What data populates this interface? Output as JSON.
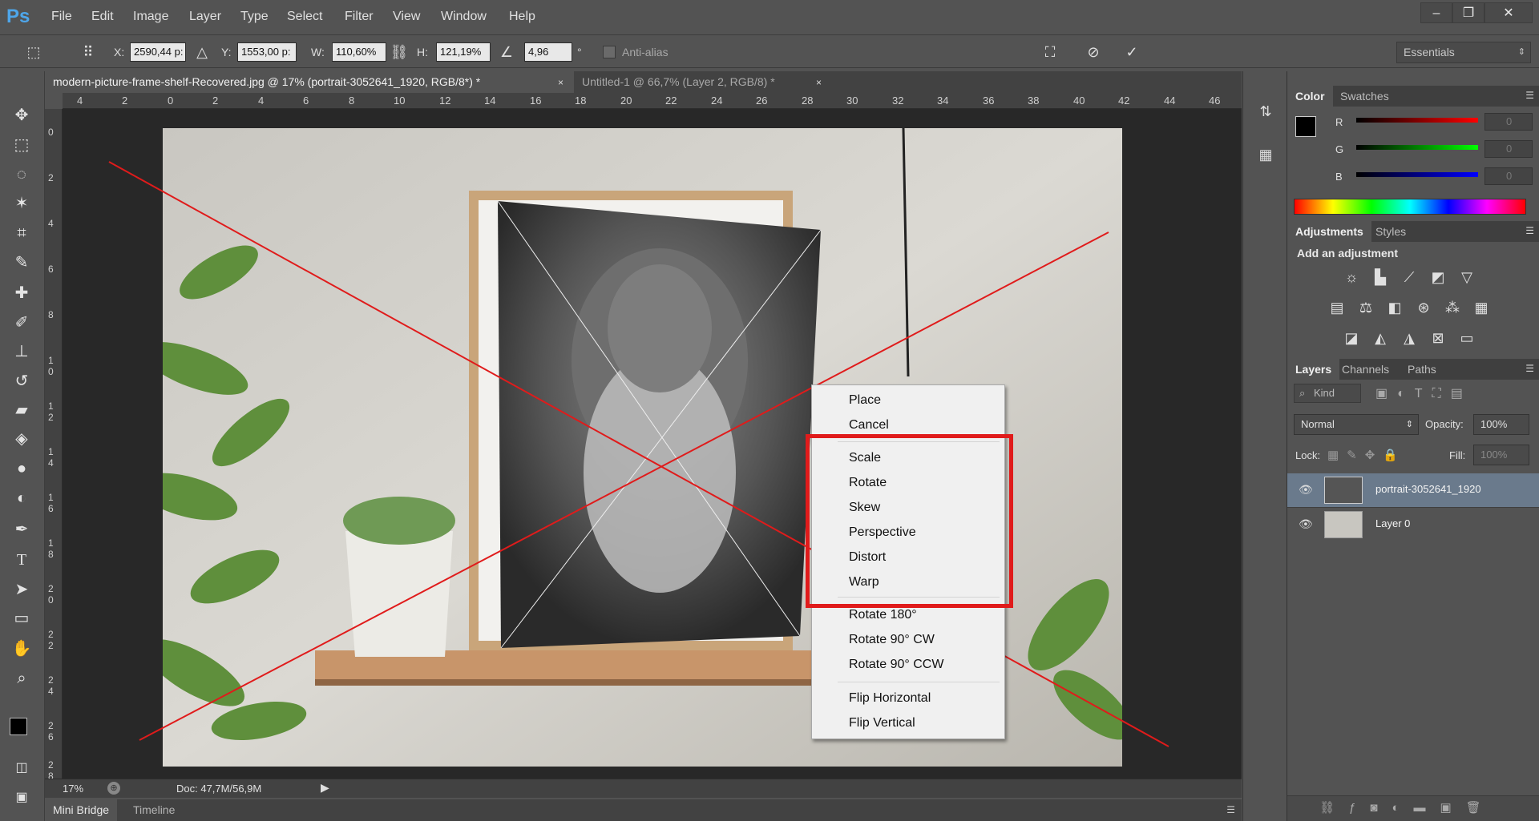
{
  "app": {
    "logo": "Ps"
  },
  "menu": [
    "File",
    "Edit",
    "Image",
    "Layer",
    "Type",
    "Select",
    "Filter",
    "View",
    "Window",
    "Help"
  ],
  "window_controls": {
    "minimize": "–",
    "restore": "❐",
    "close": "✕"
  },
  "options": {
    "x_label": "X:",
    "x_value": "2590,44 p:",
    "y_label": "Y:",
    "y_value": "1553,00 p:",
    "w_label": "W:",
    "w_value": "110,60%",
    "h_label": "H:",
    "h_value": "121,19%",
    "angle_value": "4,96",
    "degree": "°",
    "antialias": "Anti-alias",
    "workspace": "Essentials"
  },
  "tabs": [
    {
      "label": "modern-picture-frame-shelf-Recovered.jpg @ 17% (portrait-3052641_1920, RGB/8*) *",
      "close": "×"
    },
    {
      "label": "Untitled-1 @ 66,7% (Layer 2, RGB/8) *",
      "close": "×"
    }
  ],
  "ruler_top": [
    "4",
    "2",
    "0",
    "2",
    "4",
    "6",
    "8",
    "10",
    "12",
    "14",
    "16",
    "18",
    "20",
    "22",
    "24",
    "26",
    "28",
    "30",
    "32",
    "34",
    "36",
    "38",
    "40",
    "42",
    "44",
    "46"
  ],
  "ruler_left": [
    "0",
    "2",
    "4",
    "6",
    "8",
    "1 0",
    "1 2",
    "1 4",
    "1 6",
    "1 8",
    "2 0",
    "2 2",
    "2 4",
    "2 6",
    "2 8"
  ],
  "status": {
    "zoom": "17%",
    "doc": "Doc: 47,7M/56,9M"
  },
  "bottom_tabs": [
    "Mini Bridge",
    "Timeline"
  ],
  "color_panel": {
    "tabs": [
      "Color",
      "Swatches"
    ],
    "r_label": "R",
    "g_label": "G",
    "b_label": "B",
    "r_value": "0",
    "g_value": "0",
    "b_value": "0",
    "fg": "#000000",
    "bg": "#ffffff"
  },
  "adjustments_panel": {
    "tabs": [
      "Adjustments",
      "Styles"
    ],
    "title": "Add an adjustment"
  },
  "layers_panel": {
    "tabs": [
      "Layers",
      "Channels",
      "Paths"
    ],
    "kind": "Kind",
    "blend_mode": "Normal",
    "opacity_label": "Opacity:",
    "opacity_value": "100%",
    "lock_label": "Lock:",
    "fill_label": "Fill:",
    "fill_value": "100%",
    "layers": [
      {
        "name": "portrait-3052641_1920",
        "selected": true
      },
      {
        "name": "Layer 0",
        "selected": false
      }
    ]
  },
  "context_menu": {
    "group1": [
      "Place",
      "Cancel"
    ],
    "group2": [
      "Scale",
      "Rotate",
      "Skew",
      "Perspective",
      "Distort",
      "Warp"
    ],
    "group3": [
      "Rotate 180°",
      "Rotate 90° CW",
      "Rotate 90° CCW"
    ],
    "group4": [
      "Flip Horizontal",
      "Flip Vertical"
    ]
  },
  "colors": {
    "accent_red": "#e01b1b",
    "ps_blue": "#4ea6ea",
    "selected_layer": "#6a7a8c"
  }
}
